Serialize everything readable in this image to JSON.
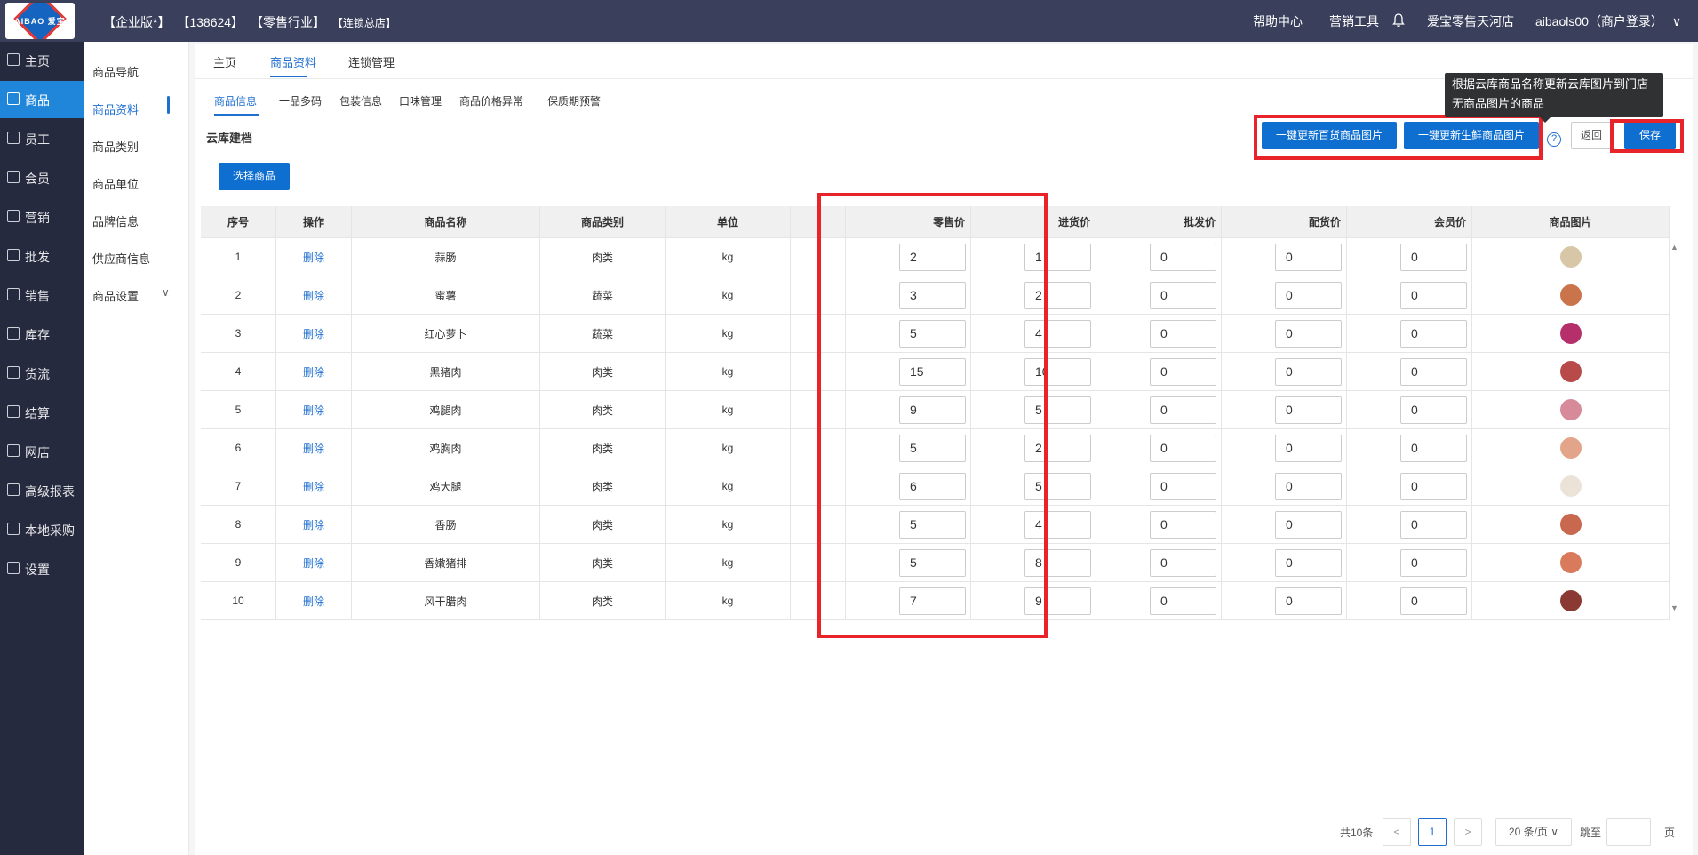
{
  "logo": {
    "text": "AIBAO 爱宝"
  },
  "header": {
    "edition": "【企业版*】",
    "account_id": "【138624】",
    "industry": "【零售行业】",
    "store": "【连锁总店】",
    "nav": {
      "help": "帮助中心",
      "marketing_tools": "营销工具",
      "shop_name": "爱宝零售天河店",
      "user": "aibaols00（商户登录）",
      "user_chevron": "∨"
    }
  },
  "left_nav": [
    {
      "label": "主页",
      "icon": "home-icon"
    },
    {
      "label": "商品",
      "icon": "goods-icon",
      "active": true
    },
    {
      "label": "员工",
      "icon": "staff-icon"
    },
    {
      "label": "会员",
      "icon": "member-icon"
    },
    {
      "label": "营销",
      "icon": "marketing-icon"
    },
    {
      "label": "批发",
      "icon": "wholesale-icon"
    },
    {
      "label": "销售",
      "icon": "sales-chart-icon"
    },
    {
      "label": "库存",
      "icon": "inventory-icon"
    },
    {
      "label": "货流",
      "icon": "logistics-icon"
    },
    {
      "label": "结算",
      "icon": "settlement-icon"
    },
    {
      "label": "网店",
      "icon": "shop-icon"
    },
    {
      "label": "高级报表",
      "icon": "report-icon"
    },
    {
      "label": "本地采购",
      "icon": "purchase-icon"
    },
    {
      "label": "设置",
      "icon": "settings-icon"
    }
  ],
  "sub_nav": [
    {
      "label": "商品导航"
    },
    {
      "label": "商品资料",
      "active": true
    },
    {
      "label": "商品类别"
    },
    {
      "label": "商品单位"
    },
    {
      "label": "品牌信息"
    },
    {
      "label": "供应商信息"
    },
    {
      "label": "商品设置"
    }
  ],
  "tabs_top": [
    "主页",
    "商品资料",
    "连锁管理"
  ],
  "tabs_sub": [
    "商品信息",
    "一品多码",
    "包装信息",
    "口味管理",
    "商品价格异常",
    "保质期预警"
  ],
  "section_title": "云库建档",
  "buttons": {
    "select_goods": "选择商品",
    "update_general": "一键更新百货商品图片",
    "update_fresh": "一键更新生鲜商品图片",
    "help": "?",
    "back": "返回",
    "save": "保存"
  },
  "tooltip": "根据云库商品名称更新云库图片到门店无商品图片的商品",
  "table": {
    "headers": [
      "序号",
      "操作",
      "商品名称",
      "商品类别",
      "单位",
      "",
      "零售价",
      "进货价",
      "批发价",
      "配货价",
      "会员价",
      "商品图片"
    ],
    "delete_label": "删除",
    "rows": [
      {
        "no": "1",
        "name": "蒜肠",
        "category": "肉类",
        "unit": "kg",
        "retail": "2",
        "purchase": "1",
        "wholesale": "0",
        "distribution": "0",
        "member": "0",
        "img_color": "#d8c7a6"
      },
      {
        "no": "2",
        "name": "蜜薯",
        "category": "蔬菜",
        "unit": "kg",
        "retail": "3",
        "purchase": "2",
        "wholesale": "0",
        "distribution": "0",
        "member": "0",
        "img_color": "#c9744a"
      },
      {
        "no": "3",
        "name": "红心萝卜",
        "category": "蔬菜",
        "unit": "kg",
        "retail": "5",
        "purchase": "4",
        "wholesale": "0",
        "distribution": "0",
        "member": "0",
        "img_color": "#b5306a"
      },
      {
        "no": "4",
        "name": "黑猪肉",
        "category": "肉类",
        "unit": "kg",
        "retail": "15",
        "purchase": "10",
        "wholesale": "0",
        "distribution": "0",
        "member": "0",
        "img_color": "#b84a4a"
      },
      {
        "no": "5",
        "name": "鸡腿肉",
        "category": "肉类",
        "unit": "kg",
        "retail": "9",
        "purchase": "5",
        "wholesale": "0",
        "distribution": "0",
        "member": "0",
        "img_color": "#d68a9a"
      },
      {
        "no": "6",
        "name": "鸡胸肉",
        "category": "肉类",
        "unit": "kg",
        "retail": "5",
        "purchase": "2",
        "wholesale": "0",
        "distribution": "0",
        "member": "0",
        "img_color": "#e2a58a"
      },
      {
        "no": "7",
        "name": "鸡大腿",
        "category": "肉类",
        "unit": "kg",
        "retail": "6",
        "purchase": "5",
        "wholesale": "0",
        "distribution": "0",
        "member": "0",
        "img_color": "#ece3d8"
      },
      {
        "no": "8",
        "name": "香肠",
        "category": "肉类",
        "unit": "kg",
        "retail": "5",
        "purchase": "4",
        "wholesale": "0",
        "distribution": "0",
        "member": "0",
        "img_color": "#c8684e"
      },
      {
        "no": "9",
        "name": "香嫩猪排",
        "category": "肉类",
        "unit": "kg",
        "retail": "5",
        "purchase": "8",
        "wholesale": "0",
        "distribution": "0",
        "member": "0",
        "img_color": "#d97a5c"
      },
      {
        "no": "10",
        "name": "风干腊肉",
        "category": "肉类",
        "unit": "kg",
        "retail": "7",
        "purchase": "9",
        "wholesale": "0",
        "distribution": "0",
        "member": "0",
        "img_color": "#8a3a32"
      }
    ]
  },
  "pagination": {
    "total": "共10条",
    "prev": "<",
    "current": "1",
    "next": ">",
    "page_size": "20 条/页",
    "page_size_chevron": "∨",
    "jump_label": "跳至",
    "jump_value": "",
    "page_unit": "页"
  }
}
